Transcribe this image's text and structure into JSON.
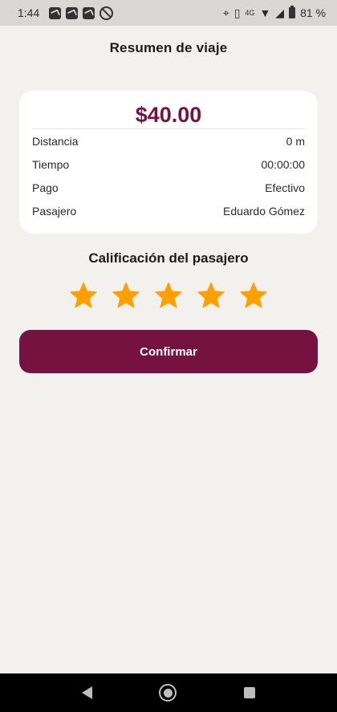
{
  "status_bar": {
    "time": "1:44",
    "battery_percent": "81 %",
    "network_label": "4G",
    "icons": [
      "app-notification-icon",
      "app-notification-icon",
      "app-notification-icon",
      "sync-off-icon",
      "location-icon",
      "vibrate-icon",
      "volte-call-icon",
      "wifi-icon",
      "signal-icon",
      "battery-icon"
    ]
  },
  "page": {
    "title": "Resumen de viaje"
  },
  "summary": {
    "amount": "$40.00",
    "rows": [
      {
        "label": "Distancia",
        "value": "0 m"
      },
      {
        "label": "Tiempo",
        "value": "00:00:00"
      },
      {
        "label": "Pago",
        "value": "Efectivo"
      },
      {
        "label": "Pasajero",
        "value": "Eduardo Gómez"
      }
    ]
  },
  "rating": {
    "title": "Calificación del pasajero",
    "value": 5,
    "max": 5,
    "star_color": "#ffa000"
  },
  "actions": {
    "confirm_label": "Confirmar"
  },
  "colors": {
    "accent": "#75123f",
    "background": "#f3f1ed",
    "card": "#ffffff"
  },
  "nav_bar": {
    "icons": [
      "back-icon",
      "home-icon",
      "recents-icon"
    ]
  }
}
